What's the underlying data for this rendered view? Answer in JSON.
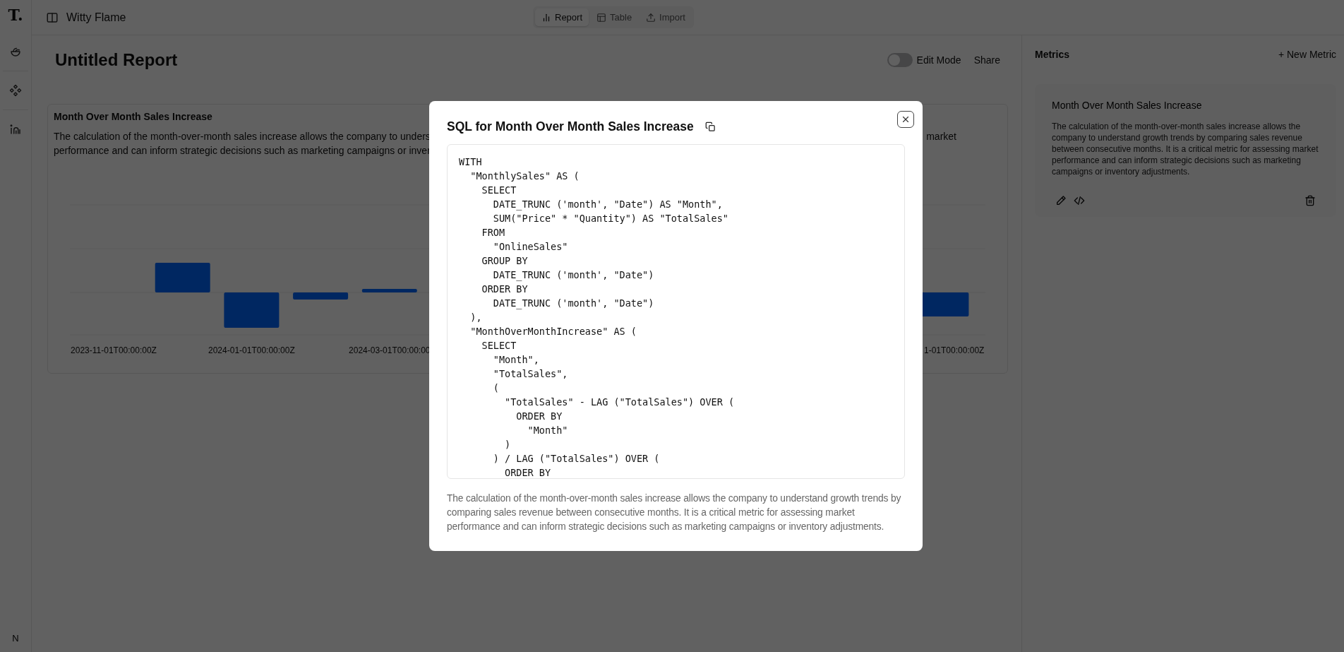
{
  "sidebar": {
    "logo": "T.",
    "user_initial": "N"
  },
  "topbar": {
    "project_name": "Witty Flame",
    "view_tabs": [
      {
        "label": "Report",
        "selected": true
      },
      {
        "label": "Table",
        "selected": false
      },
      {
        "label": "Import",
        "selected": false
      }
    ]
  },
  "report": {
    "title": "Untitled Report",
    "edit_mode": {
      "label": "Edit Mode",
      "on": false
    },
    "share_label": "Share",
    "chart_card": {
      "title": "Month Over Month Sales Increase",
      "description_left_lines": [
        "The calculation of the month-over-month sales increase allows the company to unders",
        "performance and can inform strategic decisions such as marketing campaigns or inver"
      ],
      "description_right_lines": [
        "market"
      ],
      "x_labels": [
        "2023-11-01T00:00:00Z",
        "2024-01-01T00:00:00Z",
        "2024-03-01T00:00:00",
        "1-01T00:00:00Z"
      ]
    }
  },
  "metrics_panel": {
    "title": "Metrics",
    "new_metric_label": "+ New Metric",
    "metrics": [
      {
        "name": "Month Over Month Sales Increase",
        "description": "The calculation of the month-over-month sales increase allows the company to understand growth trends by comparing sales revenue between consecutive months. It is a critical metric for assessing market performance and can inform strategic decisions such as marketing campaigns or inventory adjustments."
      }
    ]
  },
  "modal": {
    "title": "SQL for Month Over Month Sales Increase",
    "sql": "WITH\n  \"MonthlySales\" AS (\n    SELECT\n      DATE_TRUNC ('month', \"Date\") AS \"Month\",\n      SUM(\"Price\" * \"Quantity\") AS \"TotalSales\"\n    FROM\n      \"OnlineSales\"\n    GROUP BY\n      DATE_TRUNC ('month', \"Date\")\n    ORDER BY\n      DATE_TRUNC ('month', \"Date\")\n  ),\n  \"MonthOverMonthIncrease\" AS (\n    SELECT\n      \"Month\",\n      \"TotalSales\",\n      (\n        \"TotalSales\" - LAG (\"TotalSales\") OVER (\n          ORDER BY\n            \"Month\"\n        )\n      ) / LAG (\"TotalSales\") OVER (\n        ORDER BY",
    "description": "The calculation of the month-over-month sales increase allows the company to understand growth trends by comparing sales revenue between consecutive months. It is a critical metric for assessing market performance and can inform strategic decisions such as marketing campaigns or inventory adjustments."
  }
}
